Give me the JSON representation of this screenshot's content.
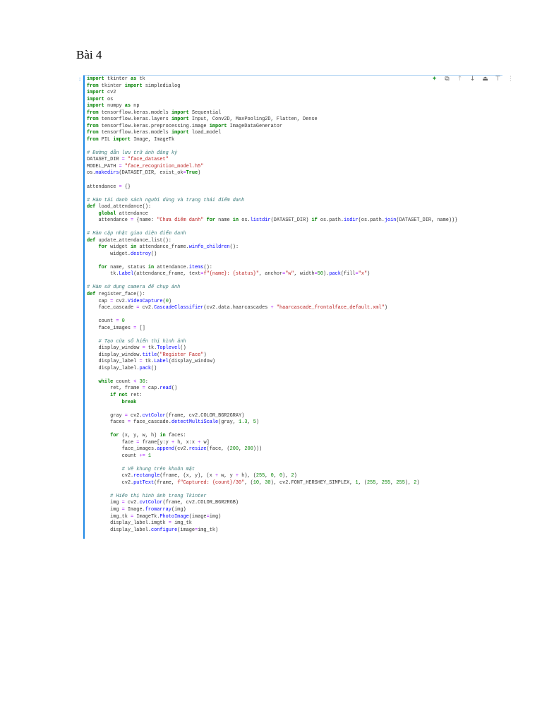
{
  "heading": "Bài 4",
  "cell": {
    "prompt": ":",
    "toolbar": [
      {
        "icon": "sparkle-icon",
        "glyph": "✦"
      },
      {
        "icon": "copy-icon",
        "glyph": "⧉"
      },
      {
        "icon": "move-up-icon",
        "glyph": "↑"
      },
      {
        "icon": "move-down-icon",
        "glyph": "↓"
      },
      {
        "icon": "insert-above-icon",
        "glyph": "⏏"
      },
      {
        "icon": "insert-below-icon",
        "glyph": "⊤"
      },
      {
        "icon": "more-icon",
        "glyph": "⋮"
      }
    ],
    "code_lines": [
      "import tkinter as tk",
      "from tkinter import simpledialog",
      "import cv2",
      "import os",
      "import numpy as np",
      "from tensorflow.keras.models import Sequential",
      "from tensorflow.keras.layers import Input, Conv2D, MaxPooling2D, Flatten, Dense",
      "from tensorflow.keras.preprocessing.image import ImageDataGenerator",
      "from tensorflow.keras.models import load_model",
      "from PIL import Image, ImageTk",
      "",
      "# Đường dẫn lưu trữ ảnh đăng ký",
      "DATASET_DIR = \"face_dataset\"",
      "MODEL_PATH = \"face_recognition_model.h5\"",
      "os.makedirs(DATASET_DIR, exist_ok=True)",
      "",
      "attendance = {}",
      "",
      "# Hàm tải danh sách người dùng và trạng thái điểm danh",
      "def load_attendance():",
      "    global attendance",
      "    attendance = {name: \"Chưa điểm danh\" for name in os.listdir(DATASET_DIR) if os.path.isdir(os.path.join(DATASET_DIR, name))}",
      "",
      "# Hàm cập nhật giao diện điểm danh",
      "def update_attendance_list():",
      "    for widget in attendance_frame.winfo_children():",
      "        widget.destroy()",
      "",
      "    for name, status in attendance.items():",
      "        tk.Label(attendance_frame, text=f\"{name}: {status}\", anchor=\"w\", width=50).pack(fill=\"x\")",
      "",
      "# Hàm sử dụng camera để chụp ảnh",
      "def register_face():",
      "    cap = cv2.VideoCapture(0)",
      "    face_cascade = cv2.CascadeClassifier(cv2.data.haarcascades + \"haarcascade_frontalface_default.xml\")",
      "",
      "    count = 0",
      "    face_images = []",
      "",
      "    # Tạo cửa sổ hiển thị hình ảnh",
      "    display_window = tk.Toplevel()",
      "    display_window.title(\"Register Face\")",
      "    display_label = tk.Label(display_window)",
      "    display_label.pack()",
      "",
      "    while count < 30:",
      "        ret, frame = cap.read()",
      "        if not ret:",
      "            break",
      "",
      "        gray = cv2.cvtColor(frame, cv2.COLOR_BGR2GRAY)",
      "        faces = face_cascade.detectMultiScale(gray, 1.3, 5)",
      "",
      "        for (x, y, w, h) in faces:",
      "            face = frame[y:y + h, x:x + w]",
      "            face_images.append(cv2.resize(face, (200, 200)))",
      "            count += 1",
      "",
      "            # Vẽ khung trên khuôn mặt",
      "            cv2.rectangle(frame, (x, y), (x + w, y + h), (255, 0, 0), 2)",
      "            cv2.putText(frame, f\"Captured: {count}/30\", (10, 30), cv2.FONT_HERSHEY_SIMPLEX, 1, (255, 255, 255), 2)",
      "",
      "        # Hiển thị hình ảnh trong Tkinter",
      "        img = cv2.cvtColor(frame, cv2.COLOR_BGR2RGB)",
      "        img = Image.fromarray(img)",
      "        img_tk = ImageTk.PhotoImage(image=img)",
      "        display_label.imgtk = img_tk",
      "        display_label.configure(image=img_tk)"
    ]
  }
}
